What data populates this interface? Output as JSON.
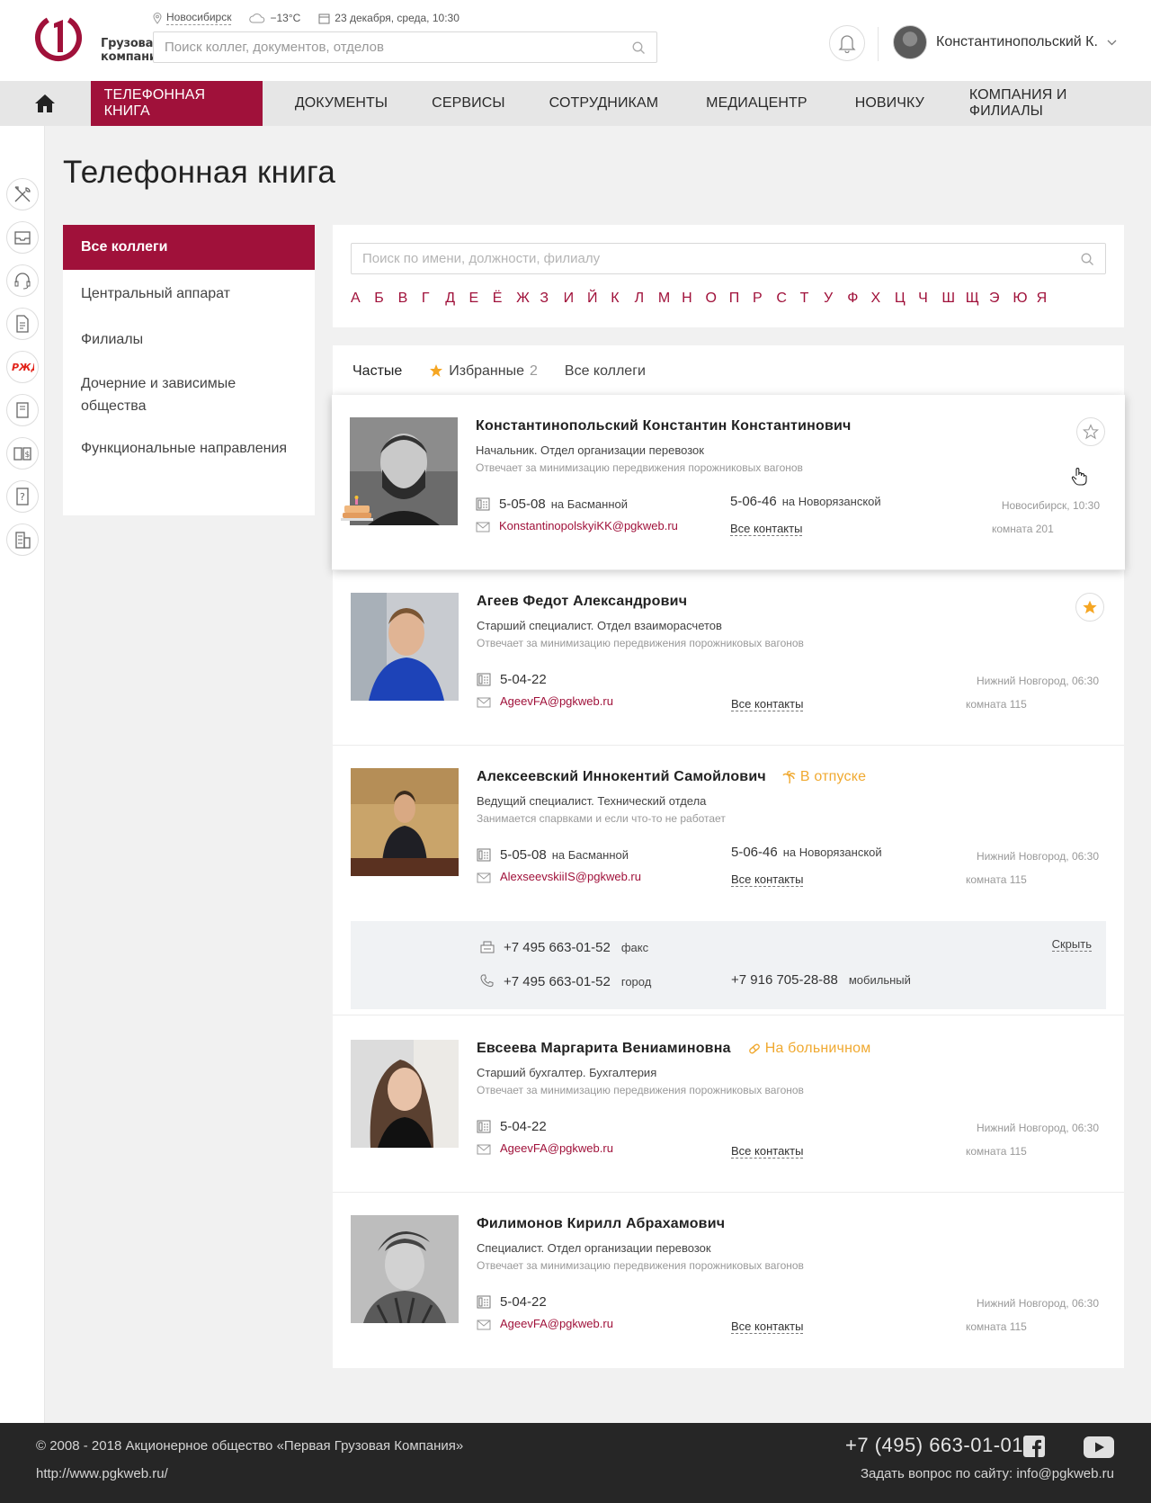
{
  "header": {
    "city": "Новосибирск",
    "weather": "−13°C",
    "datetime": "23 декабря, среда, 10:30",
    "search_placeholder": "Поиск коллег, документов, отделов",
    "logo_line1": "Грузовая",
    "logo_line2": "компания",
    "user_name": "Константинопольский К."
  },
  "nav": {
    "items": [
      "ТЕЛЕФОННАЯ КНИГА",
      "ДОКУМЕНТЫ",
      "СЕРВИСЫ",
      "СОТРУДНИКАМ",
      "МЕДИАЦЕНТР",
      "НОВИЧКУ",
      "КОМПАНИЯ И ФИЛИАЛЫ"
    ],
    "active": "ТЕЛЕФОННАЯ КНИГА"
  },
  "rail_icons": [
    "tools-icon",
    "inbox-icon",
    "headset-icon",
    "document-icon",
    "rzd-logo-icon",
    "book-icon",
    "finance-book-icon",
    "help-icon",
    "building-icon"
  ],
  "page": {
    "title": "Телефонная книга"
  },
  "sidebar": {
    "items": [
      "Все коллеги",
      "Центральный аппарат",
      "Филиалы",
      "Дочерние и зависимые общества",
      "Функциональные направления"
    ]
  },
  "filter": {
    "search_placeholder": "Поиск по имени, должности, филиалу",
    "alphabet": [
      "А",
      "Б",
      "В",
      "Г",
      "Д",
      "Е",
      "Ё",
      "Ж",
      "З",
      "И",
      "Й",
      "К",
      "Л",
      "М",
      "Н",
      "О",
      "П",
      "Р",
      "С",
      "Т",
      "У",
      "Ф",
      "Х",
      "Ц",
      "Ч",
      "Ш",
      "Щ",
      "Э",
      "Ю",
      "Я"
    ]
  },
  "tabs": {
    "frequent": "Частые",
    "favorites": "Избранные",
    "favorites_count": "2",
    "all": "Все коллеги"
  },
  "labels": {
    "all_contacts": "Все контакты",
    "hide": "Скрыть"
  },
  "people": [
    {
      "name": "Константинопольский Константин Константинович",
      "position": "Начальник. Отдел организации перевозок",
      "description": "Отвечает за минимизацию передвижения порожниковых вагонов",
      "phone1": "5-05-08",
      "phone1_place": "на Басманной",
      "phone2": "5-06-46",
      "phone2_place": "на Новорязанской",
      "email": "KonstantinopolskyiKK@pgkweb.ru",
      "location": "Новосибирск, 10:30",
      "room": "комната 201",
      "favorite": false,
      "birthday": true,
      "status": ""
    },
    {
      "name": "Агеев Федот Александрович",
      "position": "Старший специалист. Отдел взаиморасчетов",
      "description": "Отвечает за минимизацию передвижения порожниковых вагонов",
      "phone1": "5-04-22",
      "phone1_place": "",
      "email": "AgeevFA@pgkweb.ru",
      "location": "Нижний Новгород, 06:30",
      "room": "комната 115",
      "favorite": true,
      "status": ""
    },
    {
      "name": "Алексеевский Иннокентий Самойлович",
      "position": "Ведущий специалист. Технический отдела",
      "description": "Занимается спарвками и если что-то не работает",
      "phone1": "5-05-08",
      "phone1_place": "на Басманной",
      "phone2": "5-06-46",
      "phone2_place": "на Новорязанской",
      "email": "AlexseevskiiIS@pgkweb.ru",
      "location": "Нижний Новгород, 06:30",
      "room": "комната 115",
      "favorite": false,
      "status": "В отпуске",
      "extra": {
        "fax": "+7 495 663-01-52",
        "fax_label": "факс",
        "city_phone": "+7 495 663-01-52",
        "city_label": "город",
        "mobile": "+7 916 705-28-88",
        "mobile_label": "мобильный"
      }
    },
    {
      "name": "Евсеева Маргарита Вениаминовна",
      "position": "Старший бухгалтер. Бухгалтерия",
      "description": "Отвечает за минимизацию передвижения порожниковых вагонов",
      "phone1": "5-04-22",
      "phone1_place": "",
      "email": "AgeevFA@pgkweb.ru",
      "location": "Нижний Новгород, 06:30",
      "room": "комната 115",
      "favorite": false,
      "status": "На больничном"
    },
    {
      "name": "Филимонов Кирилл Абрахамович",
      "position": "Специалист. Отдел организации перевозок",
      "description": "Отвечает за минимизацию передвижения порожниковых вагонов",
      "phone1": "5-04-22",
      "phone1_place": "",
      "email": "AgeevFA@pgkweb.ru",
      "location": "Нижний Новгород, 06:30",
      "room": "комната 115",
      "favorite": false,
      "status": ""
    }
  ],
  "footer": {
    "copyright": "© 2008 - 2018 Акционерное общество «Первая Грузовая Компания»",
    "url": "http://www.pgkweb.ru/",
    "phone": "+7 (495) 663-01-01",
    "ask_label": "Задать вопрос по сайту:",
    "ask_email": "info@pgkweb.ru"
  },
  "colors": {
    "brand": "#a0113a",
    "status": "#f0a930",
    "star": "#f5a623"
  }
}
